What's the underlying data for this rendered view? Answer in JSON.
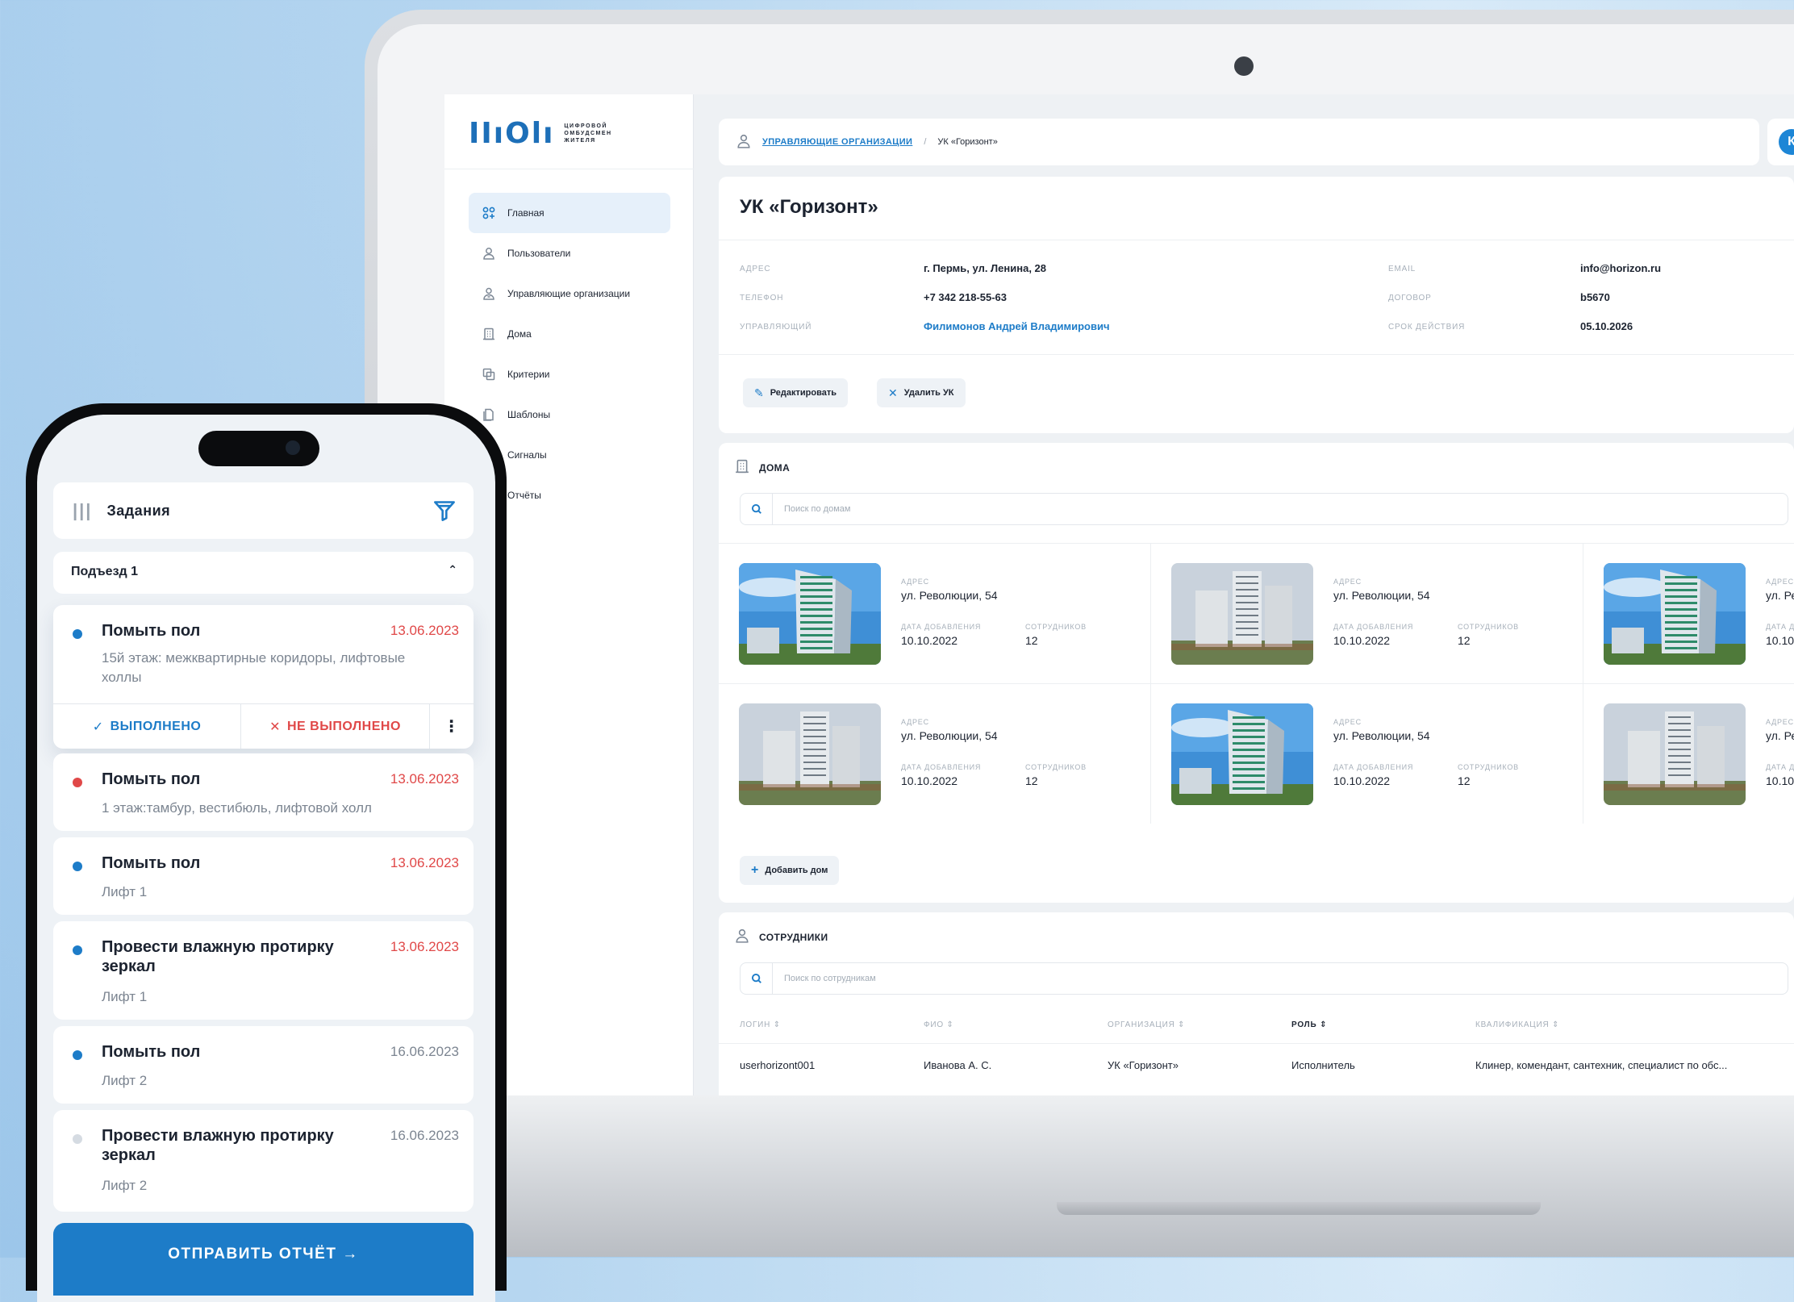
{
  "colors": {
    "accent": "#1d7cc8",
    "date_overdue": "#e04848",
    "dot_blue": "#1d7cc8",
    "dot_red": "#e04848",
    "dot_grey": "#d5dbe2"
  },
  "web": {
    "logo": {
      "mark": "IIıOlı",
      "text": "цифровой омбудсмен жителя"
    },
    "sidebar": {
      "items": [
        {
          "label": "Главная",
          "icon": "grid-plus-icon",
          "active": true
        },
        {
          "label": "Пользователи",
          "icon": "user-icon"
        },
        {
          "label": "Управляющие организации",
          "icon": "user-badge-icon"
        },
        {
          "label": "Дома",
          "icon": "building-icon"
        },
        {
          "label": "Критерии",
          "icon": "criteria-icon"
        },
        {
          "label": "Шаблоны",
          "icon": "template-icon"
        },
        {
          "label": "Сигналы",
          "icon": "signal-icon"
        },
        {
          "label": "Отчёты",
          "icon": "report-icon"
        }
      ]
    },
    "breadcrumb": {
      "link": "Управляющие организации",
      "sep": "/",
      "current": "УК «Горизонт»"
    },
    "avatar": "К",
    "org": {
      "title": "УК «Горизонт»",
      "address_label": "Адрес",
      "address": "г. Пермь, ул. Ленина, 28",
      "phone_label": "Телефон",
      "phone": "+7 342 218-55-63",
      "manager_label": "Управляющий",
      "manager": "Филимонов Андрей Владимирович",
      "email_label": "Email",
      "email": "info@horizon.ru",
      "contract_label": "Договор",
      "contract": "b5670",
      "valid_label": "Срок действия",
      "valid": "05.10.2026",
      "edit_btn": "Редактировать",
      "delete_btn": "Удалить УК"
    },
    "houses": {
      "title": "Дома",
      "search_placeholder": "Поиск по домам",
      "address_label": "Адрес",
      "date_label": "Дата добавления",
      "staff_label": "Сотрудников",
      "items": [
        {
          "address": "ул. Революции, 54",
          "date": "10.10.2022",
          "staff": "12"
        },
        {
          "address": "ул. Революции, 54",
          "date": "10.10.2022",
          "staff": "12"
        },
        {
          "address": "ул. Ре",
          "date": "10.10.",
          "staff": ""
        },
        {
          "address": "ул. Революции, 54",
          "date": "10.10.2022",
          "staff": "12"
        },
        {
          "address": "ул. Революции, 54",
          "date": "10.10.2022",
          "staff": "12"
        },
        {
          "address": "ул. Ре",
          "date": "10.10.",
          "staff": ""
        }
      ],
      "add_btn": "Добавить дом"
    },
    "staff": {
      "title": "Сотрудники",
      "search_placeholder": "Поиск по сотрудникам",
      "columns": [
        "Логин",
        "ФИО",
        "Организация",
        "Роль",
        "Квалификация"
      ],
      "rows": [
        {
          "login": "userhorizont001",
          "name": "Иванова А. С.",
          "org": "УК «Горизонт»",
          "role": "Исполнитель",
          "qual": "Клинер, комендант, сантехник, специалист по обс..."
        }
      ]
    }
  },
  "mobile": {
    "header": "Задания",
    "group": "Подъезд 1",
    "tasks": [
      {
        "name": "Помыть пол",
        "date": "13.06.2023",
        "sub": "15й этаж: межквартирные коридоры, лифтовые холлы",
        "dot": "blue",
        "overdue": true
      },
      {
        "name": "Помыть пол",
        "date": "13.06.2023",
        "sub": "1 этаж:тамбур, вестибюль, лифтовой холл",
        "dot": "red",
        "overdue": true
      },
      {
        "name": "Помыть пол",
        "date": "13.06.2023",
        "sub": "Лифт 1",
        "dot": "blue",
        "overdue": true
      },
      {
        "name": "Провести влажную протирку зеркал",
        "date": "13.06.2023",
        "sub": "Лифт 1",
        "dot": "blue",
        "overdue": true
      },
      {
        "name": "Помыть пол",
        "date": "16.06.2023",
        "sub": "Лифт 2",
        "dot": "blue",
        "overdue": false
      },
      {
        "name": "Провести влажную протирку зеркал",
        "date": "16.06.2023",
        "sub": "Лифт 2",
        "dot": "grey",
        "overdue": false
      }
    ],
    "done_btn": "Выполнено",
    "not_done_btn": "Не выполнено",
    "send_btn": "Отправить отчёт →"
  }
}
